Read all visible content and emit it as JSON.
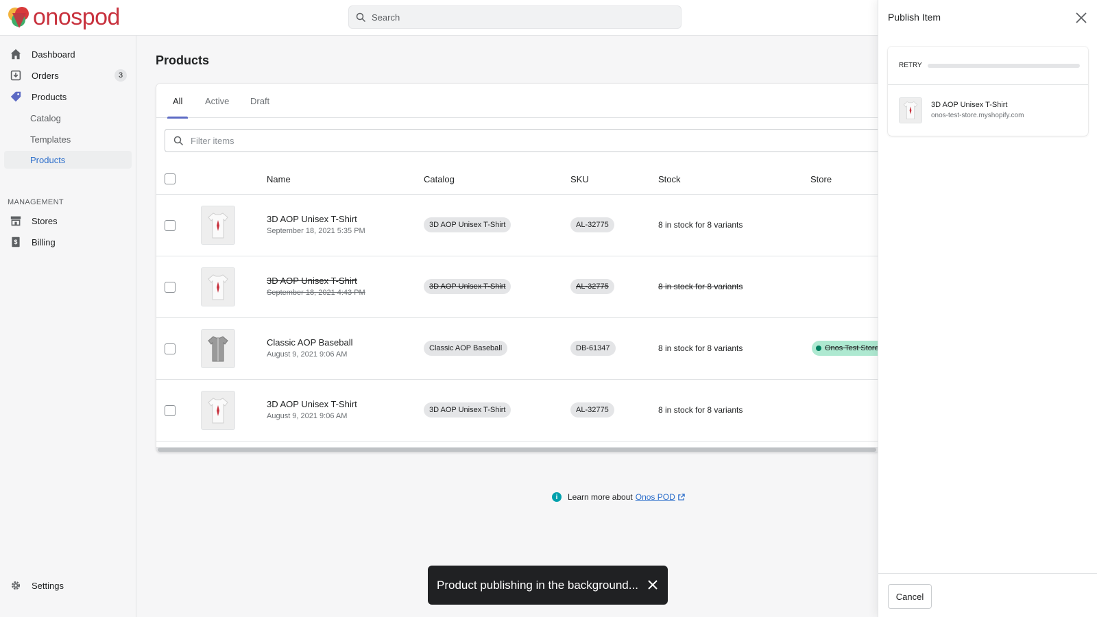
{
  "app": {
    "logo_text": "onospod"
  },
  "search": {
    "placeholder": "Search"
  },
  "sidebar": {
    "items": [
      {
        "label": "Dashboard",
        "icon": "home-icon"
      },
      {
        "label": "Orders",
        "icon": "orders-icon",
        "badge": "3"
      },
      {
        "label": "Products",
        "icon": "tag-icon"
      }
    ],
    "sub_items": [
      {
        "label": "Catalog"
      },
      {
        "label": "Templates"
      },
      {
        "label": "Products",
        "active": true
      }
    ],
    "management_label": "MANAGEMENT",
    "management_items": [
      {
        "label": "Stores",
        "icon": "store-icon"
      },
      {
        "label": "Billing",
        "icon": "billing-icon"
      }
    ],
    "settings_label": "Settings"
  },
  "main": {
    "title": "Products",
    "tabs": [
      {
        "label": "All",
        "active": true
      },
      {
        "label": "Active"
      },
      {
        "label": "Draft"
      }
    ],
    "filter_placeholder": "Filter items",
    "columns": [
      "Name",
      "Catalog",
      "SKU",
      "Stock",
      "Store"
    ],
    "rows": [
      {
        "name": "3D AOP Unisex T-Shirt",
        "date": "September 18, 2021 5:35 PM",
        "catalog": "3D AOP Unisex T-Shirt",
        "sku": "AL-32775",
        "stock": "8 in stock for 8 variants",
        "store": "",
        "struck": false
      },
      {
        "name": "3D AOP Unisex T-Shirt",
        "date": "September 18, 2021 4:43 PM",
        "catalog": "3D AOP Unisex T-Shirt",
        "sku": "AL-32775",
        "stock": "8 in stock for 8 variants",
        "store": "",
        "struck": true
      },
      {
        "name": "Classic AOP Baseball",
        "date": "August 9, 2021 9:06 AM",
        "catalog": "Classic AOP Baseball",
        "sku": "DB-61347",
        "stock": "8 in stock for 8 variants",
        "store": "Onos Test Store",
        "struck": false
      },
      {
        "name": "3D AOP Unisex T-Shirt",
        "date": "August 9, 2021 9:06 AM",
        "catalog": "3D AOP Unisex T-Shirt",
        "sku": "AL-32775",
        "stock": "8 in stock for 8 variants",
        "store": "",
        "struck": false
      }
    ],
    "learn_more_prefix": "Learn more about",
    "learn_more_link": "Onos POD"
  },
  "toast": {
    "message": "Product publishing in the background..."
  },
  "panel": {
    "title": "Publish Item",
    "retry_label": "RETRY",
    "progress": 0.0,
    "item_name": "3D AOP Unisex T-Shirt",
    "item_store": "onos-test-store.myshopify.com",
    "cancel_label": "Cancel"
  },
  "colors": {
    "accent": "#5c6ac4",
    "link": "#2c6ecb",
    "brand": "#c8323e",
    "store_badge": "#aee9d1"
  }
}
